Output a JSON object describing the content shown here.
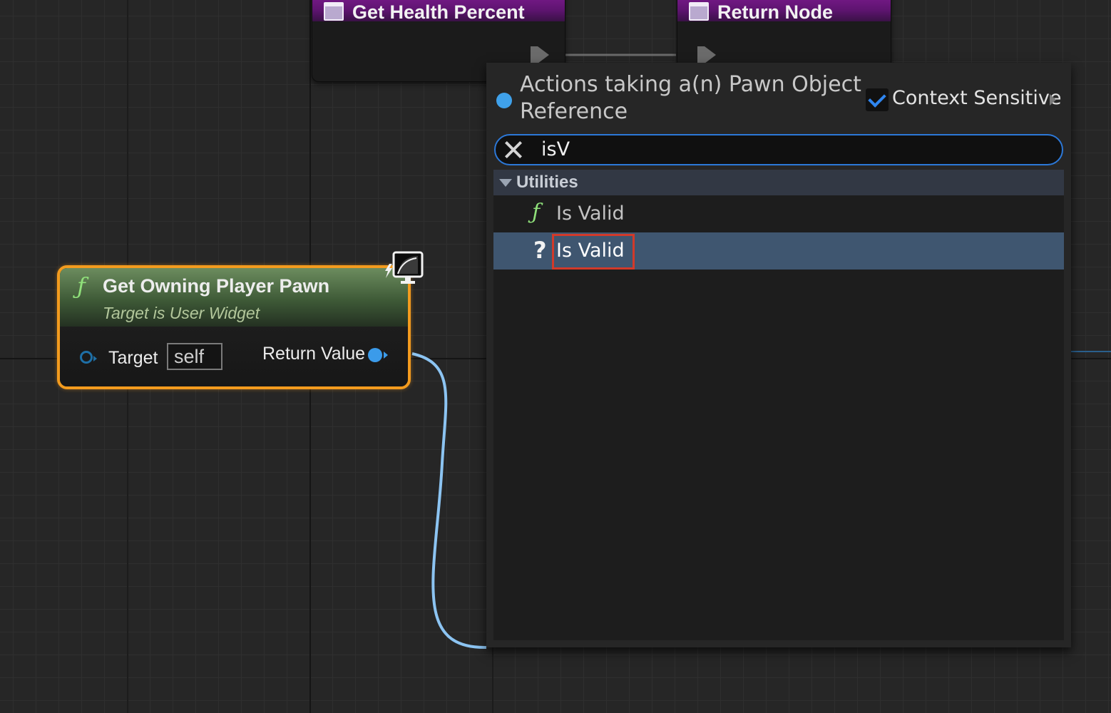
{
  "nodes": {
    "get_health_percent": {
      "title": "Get Health Percent",
      "icon": "function-graph-icon"
    },
    "return_node": {
      "title": "Return Node",
      "icon": "function-graph-icon"
    },
    "get_owning_player_pawn": {
      "function_icon": "ƒ",
      "title": "Get Owning Player Pawn",
      "subtitle": "Target is User Widget",
      "target_label": "Target",
      "target_default": "self",
      "return_label": "Return Value",
      "badge_icon": "networked-monitor-icon"
    }
  },
  "action_menu": {
    "title": "Actions taking a(n) Pawn Object Reference",
    "context_sensitive_label": "Context Sensitive",
    "context_sensitive_checked": true,
    "search_value": "isV",
    "categories": [
      {
        "label": "Utilities",
        "items": [
          {
            "icon": "ƒ",
            "label": "Is Valid",
            "selected": false
          },
          {
            "icon": "?",
            "label": "Is Valid",
            "selected": true
          }
        ]
      }
    ]
  },
  "colors": {
    "graph_background": "#262626",
    "selection_outline": "#f39b1e",
    "object_pin": "#3b9bea",
    "search_border": "#2c78d8",
    "highlight_box": "#d23a2a",
    "selected_row": "#3f5670"
  }
}
